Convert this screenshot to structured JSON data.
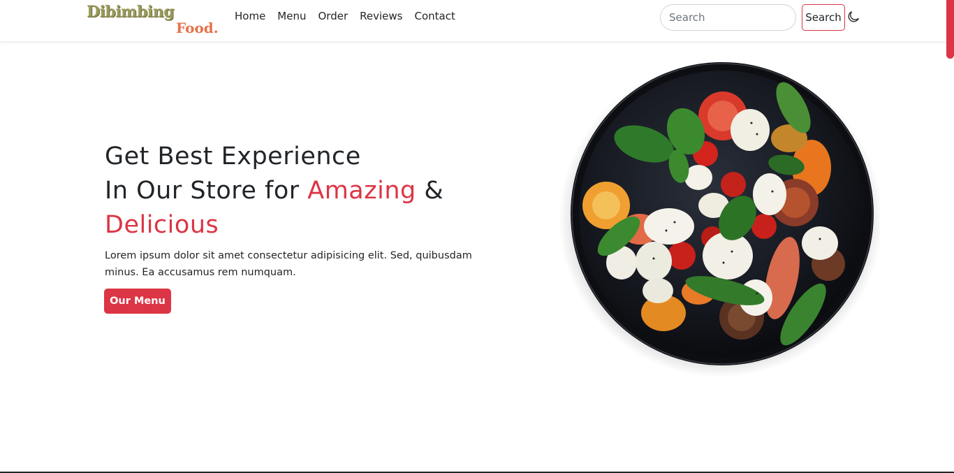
{
  "brand": {
    "line1": "Dibimbing",
    "line2": "Food."
  },
  "nav": {
    "links": [
      {
        "label": "Home"
      },
      {
        "label": "Menu"
      },
      {
        "label": "Order"
      },
      {
        "label": "Reviews"
      },
      {
        "label": "Contact"
      }
    ]
  },
  "search": {
    "placeholder": "Search",
    "button_label": "Search",
    "theme_icon": "moon-icon"
  },
  "hero": {
    "title_line1": "Get Best Experience",
    "title_line2_prefix": "In Our Store for ",
    "title_line2_accent": "Amazing",
    "title_line2_suffix": " &",
    "title_line3_accent": "Delicious",
    "description": "Lorem ipsum dolor sit amet consectetur adipisicing elit. Sed, quibusdam minus. Ea accusamus rem numquam.",
    "cta_label": "Our Menu"
  },
  "colors": {
    "accent": "#dc3545",
    "text": "#212529",
    "brand_olive": "#9a9a5c",
    "brand_orange": "#e6734a"
  }
}
